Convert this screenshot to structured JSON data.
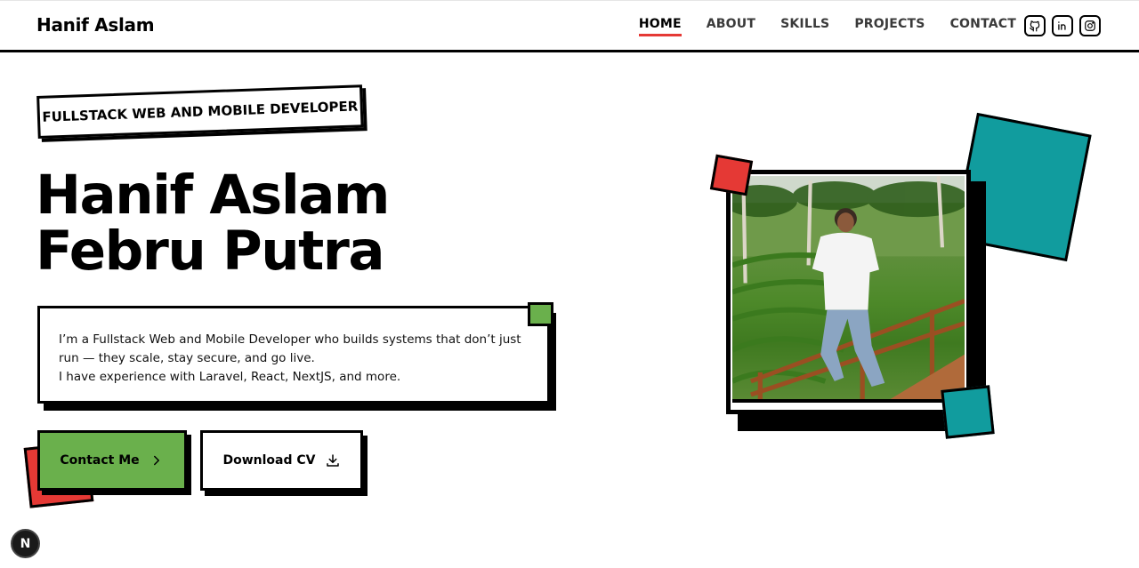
{
  "brand": "Hanif Aslam",
  "nav": {
    "items": [
      {
        "label": "HOME",
        "active": true
      },
      {
        "label": "ABOUT",
        "active": false
      },
      {
        "label": "SKILLS",
        "active": false
      },
      {
        "label": "PROJECTS",
        "active": false
      },
      {
        "label": "CONTACT",
        "active": false
      }
    ],
    "social": [
      "github-icon",
      "linkedin-icon",
      "instagram-icon"
    ]
  },
  "hero": {
    "tag": "FULLSTACK WEB AND MOBILE DEVELOPER",
    "name_line1": "Hanif Aslam",
    "name_line2": "Febru Putra",
    "desc_line1": "I’m a Fullstack Web and Mobile Developer who builds systems that don’t just run — they scale, stay secure, and go live.",
    "desc_line2": "I have experience with Laravel, React, NextJS, and more."
  },
  "buttons": {
    "contact": "Contact Me",
    "cv": "Download CV"
  },
  "badge": "N",
  "colors": {
    "accent_red": "#e53935",
    "accent_green": "#6ab04c",
    "accent_teal": "#119c9e"
  }
}
